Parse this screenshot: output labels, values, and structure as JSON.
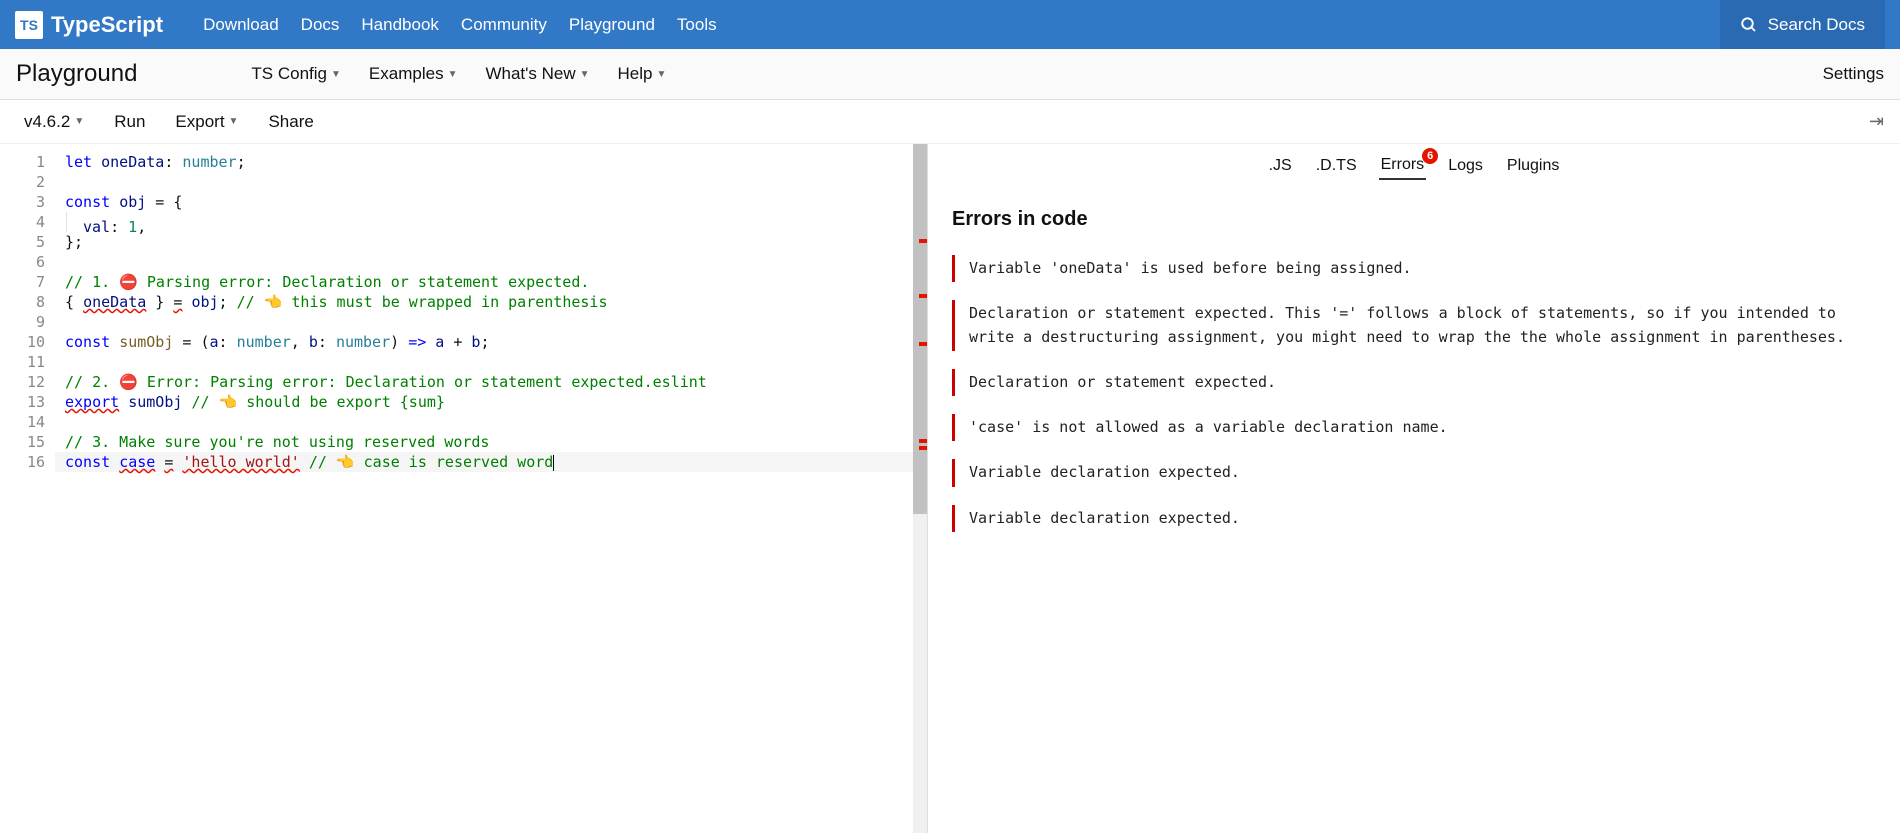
{
  "header": {
    "brand": "TypeScript",
    "logo_abbrev": "TS",
    "nav": [
      "Download",
      "Docs",
      "Handbook",
      "Community",
      "Playground",
      "Tools"
    ],
    "search_label": "Search Docs"
  },
  "subnav": {
    "title": "Playground",
    "items": [
      "TS Config",
      "Examples",
      "What's New",
      "Help"
    ],
    "settings": "Settings"
  },
  "toolbar": {
    "version": "v4.6.2",
    "run": "Run",
    "export": "Export",
    "share": "Share"
  },
  "editor": {
    "line_count": 16,
    "current_line": 16,
    "code_lines": [
      {
        "n": 1,
        "tokens": [
          {
            "t": "let ",
            "c": "tk-kw"
          },
          {
            "t": "oneData",
            "c": "tk-ident"
          },
          {
            "t": ": "
          },
          {
            "t": "number",
            "c": "tk-type"
          },
          {
            "t": ";"
          }
        ]
      },
      {
        "n": 2,
        "tokens": []
      },
      {
        "n": 3,
        "tokens": [
          {
            "t": "const ",
            "c": "tk-kw"
          },
          {
            "t": "obj",
            "c": "tk-ident"
          },
          {
            "t": " = {"
          }
        ]
      },
      {
        "n": 4,
        "tokens": [
          {
            "t": "",
            "indent": true
          },
          {
            "t": "val",
            "c": "tk-ident"
          },
          {
            "t": ": "
          },
          {
            "t": "1",
            "c": "tk-num"
          },
          {
            "t": ","
          }
        ]
      },
      {
        "n": 5,
        "tokens": [
          {
            "t": "};"
          }
        ]
      },
      {
        "n": 6,
        "tokens": []
      },
      {
        "n": 7,
        "tokens": [
          {
            "t": "// 1. ⛔ Parsing error: Declaration or statement expected.",
            "c": "tk-comment"
          }
        ]
      },
      {
        "n": 8,
        "tokens": [
          {
            "t": "{ "
          },
          {
            "t": "oneData",
            "c": "tk-ident squiggle"
          },
          {
            "t": " } "
          },
          {
            "t": "=",
            "c": "squiggle"
          },
          {
            "t": " "
          },
          {
            "t": "obj",
            "c": "tk-ident"
          },
          {
            "t": "; "
          },
          {
            "t": "// 👈 this must be wrapped in parenthesis",
            "c": "tk-comment"
          }
        ]
      },
      {
        "n": 9,
        "tokens": []
      },
      {
        "n": 10,
        "tokens": [
          {
            "t": "const ",
            "c": "tk-kw"
          },
          {
            "t": "sumObj",
            "c": "tk-fn"
          },
          {
            "t": " = ("
          },
          {
            "t": "a",
            "c": "tk-ident"
          },
          {
            "t": ": "
          },
          {
            "t": "number",
            "c": "tk-type"
          },
          {
            "t": ", "
          },
          {
            "t": "b",
            "c": "tk-ident"
          },
          {
            "t": ": "
          },
          {
            "t": "number",
            "c": "tk-type"
          },
          {
            "t": ") "
          },
          {
            "t": "=>",
            "c": "tk-kw"
          },
          {
            "t": " "
          },
          {
            "t": "a",
            "c": "tk-ident"
          },
          {
            "t": " + "
          },
          {
            "t": "b",
            "c": "tk-ident"
          },
          {
            "t": ";"
          }
        ]
      },
      {
        "n": 11,
        "tokens": []
      },
      {
        "n": 12,
        "tokens": [
          {
            "t": "// 2. ⛔ Error: Parsing error: Declaration or statement expected.eslint",
            "c": "tk-comment"
          }
        ]
      },
      {
        "n": 13,
        "tokens": [
          {
            "t": "export",
            "c": "tk-kw squiggle"
          },
          {
            "t": " "
          },
          {
            "t": "sumObj",
            "c": "tk-ident"
          },
          {
            "t": " "
          },
          {
            "t": "// 👈 should be export {sum}",
            "c": "tk-comment"
          }
        ]
      },
      {
        "n": 14,
        "tokens": []
      },
      {
        "n": 15,
        "tokens": [
          {
            "t": "// 3. Make sure you're not using reserved words",
            "c": "tk-comment"
          }
        ]
      },
      {
        "n": 16,
        "tokens": [
          {
            "t": "const ",
            "c": "tk-kw"
          },
          {
            "t": "case",
            "c": "tk-kw squiggle"
          },
          {
            "t": " "
          },
          {
            "t": "=",
            "c": "squiggle"
          },
          {
            "t": " "
          },
          {
            "t": "'hello world'",
            "c": "tk-str squiggle"
          },
          {
            "t": " "
          },
          {
            "t": "// 👈 case is reserved word",
            "c": "tk-comment"
          }
        ],
        "cursor_after": true
      }
    ],
    "error_markers": [
      95,
      150,
      198,
      295,
      302
    ]
  },
  "right": {
    "tabs": [
      ".JS",
      ".D.TS",
      "Errors",
      "Logs",
      "Plugins"
    ],
    "active_tab": "Errors",
    "error_badge": "6",
    "heading": "Errors in code",
    "errors": [
      "Variable 'oneData' is used before being assigned.",
      "Declaration or statement expected. This '=' follows a block of statements, so if you intended to write a destructuring assignment, you might need to wrap the the whole assignment in parentheses.",
      "Declaration or statement expected.",
      "'case' is not allowed as a variable declaration name.",
      "Variable declaration expected.",
      "Variable declaration expected."
    ]
  }
}
